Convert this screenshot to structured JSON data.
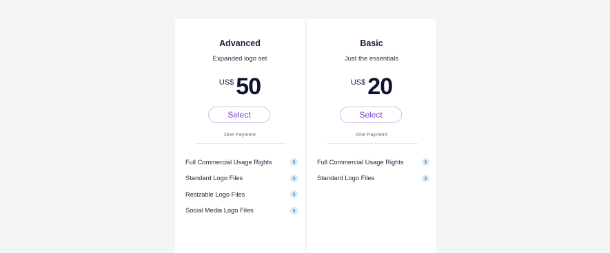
{
  "plans": [
    {
      "name": "Advanced",
      "description": "Expanded logo set",
      "currency": "US$",
      "price": "50",
      "select_label": "Select",
      "payment_note": "One Payment",
      "features": [
        "Full Commercial Usage Rights",
        "Standard Logo Files",
        "Resizable Logo Files",
        "Social Media Logo Files"
      ]
    },
    {
      "name": "Basic",
      "description": "Just the essentials",
      "currency": "US$",
      "price": "20",
      "select_label": "Select",
      "payment_note": "One Payment",
      "features": [
        "Full Commercial Usage Rights",
        "Standard Logo Files"
      ]
    }
  ],
  "icons": {
    "feature_info": "chevron-right-icon"
  },
  "colors": {
    "accent": "#7c3fd8",
    "button_border": "#cfc2ea",
    "chevron_bg": "#d9ebf8",
    "chevron_fg": "#2f7fbf",
    "page_bg": "#f3f4f6",
    "card_bg": "#ffffff"
  }
}
